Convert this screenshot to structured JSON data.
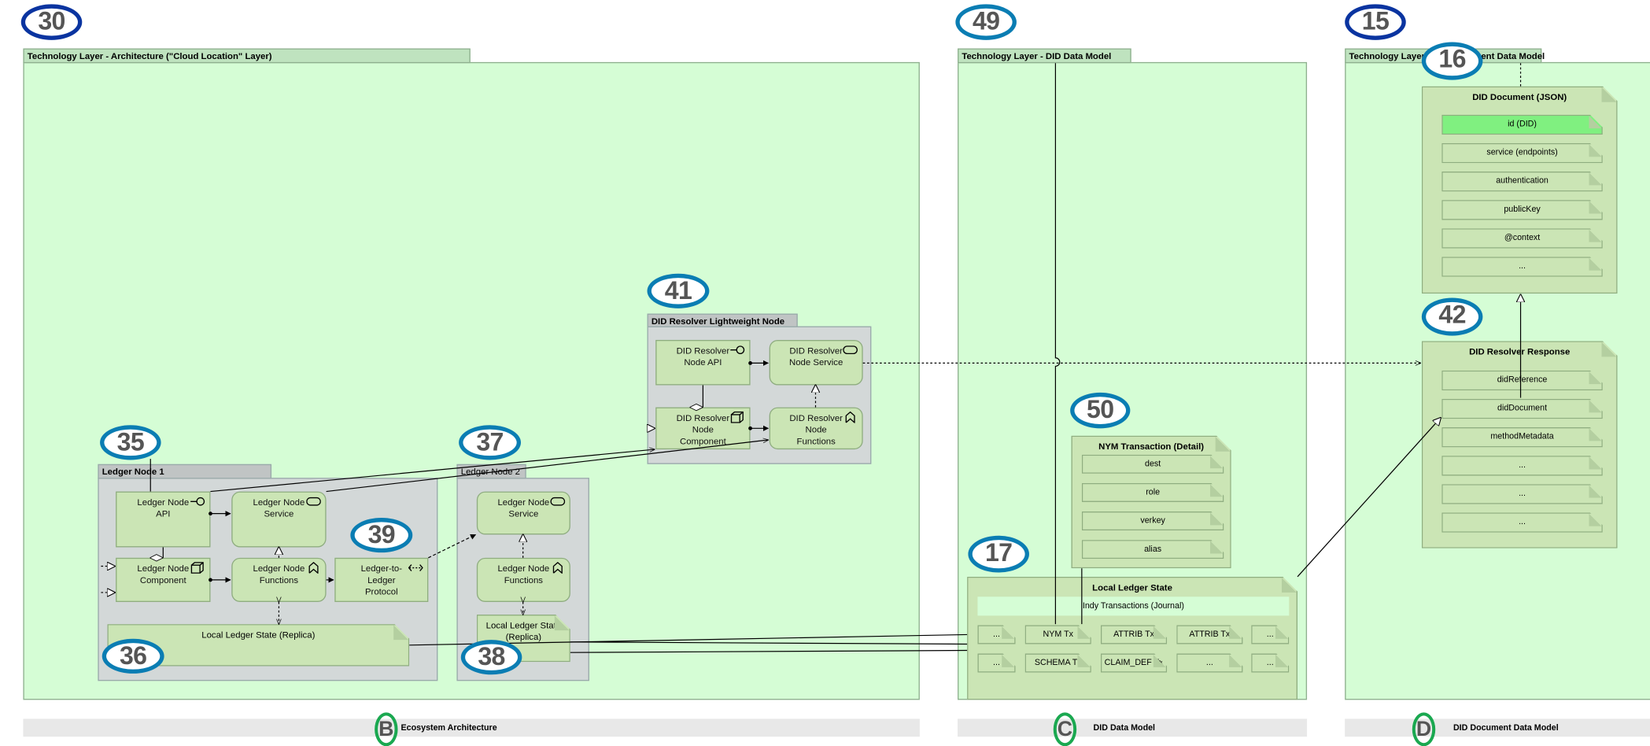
{
  "badges": {
    "b30": "30",
    "b49": "49",
    "b15": "15",
    "b16": "16",
    "b41": "41",
    "b42": "42",
    "b35": "35",
    "b37": "37",
    "b39": "39",
    "b36": "36",
    "b38": "38",
    "b50": "50",
    "b17": "17"
  },
  "groups": {
    "architecture": {
      "title": "Technology Layer - Architecture  (\"Cloud Location\" Layer)"
    },
    "did_data_model": {
      "title": "Technology Layer - DID Data Model"
    },
    "did_document_data_model": {
      "title": "Technology Layer - DID Document Data Model"
    }
  },
  "resolver_node": {
    "title": "DID Resolver Lightweight Node",
    "api": "DID Resolver\nNode API",
    "service": "DID Resolver\nNode Service",
    "component": "DID Resolver\nNode\nComponent",
    "functions": "DID Resolver\nNode\nFunctions"
  },
  "ledger_node_1": {
    "title": "Ledger Node 1",
    "api": "Ledger Node\nAPI",
    "service": "Ledger Node\nService",
    "component": "Ledger Node\nComponent",
    "functions": "Ledger Node\nFunctions",
    "protocol": "Ledger-to-\nLedger\nProtocol",
    "state": "Local Ledger State (Replica)"
  },
  "ledger_node_2": {
    "title": "Ledger Node 2",
    "service": "Ledger Node\nService",
    "functions": "Ledger Node\nFunctions",
    "state": "Local Ledger State\n(Replica)"
  },
  "nym_transaction": {
    "title": "NYM Transaction (Detail)",
    "fields": [
      "dest",
      "role",
      "verkey",
      "alias"
    ]
  },
  "local_ledger_state": {
    "title": "Local Ledger State",
    "journal": "Indy Transactions (Journal)",
    "row1": [
      "...",
      "NYM Tx",
      "ATTRIB Tx",
      "ATTRIB Tx",
      "..."
    ],
    "row2": [
      "...",
      "SCHEMA Tx",
      "CLAIM_DEF Tx",
      "...",
      "..."
    ]
  },
  "did_document": {
    "title": "DID Document (JSON)",
    "fields": [
      "id (DID)",
      "service (endpoints)",
      "authentication",
      "publicKey",
      "@context",
      "..."
    ],
    "highlight_color": "#80f080"
  },
  "did_resolver_response": {
    "title": "DID Resolver Response",
    "fields": [
      "didReference",
      "didDocument",
      "methodMetadata",
      "...",
      "...",
      "..."
    ]
  },
  "footer": {
    "sections": [
      {
        "letter": "B",
        "label": "Ecosystem Architecture"
      },
      {
        "letter": "C",
        "label": "DID Data Model"
      },
      {
        "letter": "D",
        "label": "DID Document Data Model"
      }
    ]
  },
  "colors": {
    "group_fill": "#d5fdd5",
    "element_fill": "#cbe5b5",
    "node_fill": "#d3d8d8",
    "badge_blue": "#0a7db3",
    "badge_dark_blue": "#0a34a0",
    "footer_circle": "#1aa850"
  }
}
